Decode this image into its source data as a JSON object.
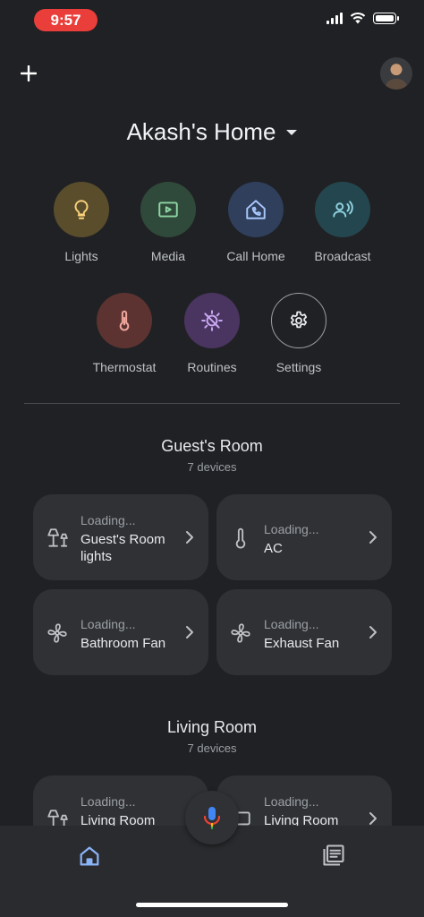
{
  "status_bar": {
    "time": "9:57"
  },
  "header": {
    "home_name": "Akash's Home"
  },
  "quick_actions": [
    {
      "label": "Lights",
      "icon": "lightbulb-icon",
      "bg": "#5a4d2c",
      "fg": "#f9d27a"
    },
    {
      "label": "Media",
      "icon": "media-play-icon",
      "bg": "#2f4a3a",
      "fg": "#8fd6a4"
    },
    {
      "label": "Call Home",
      "icon": "call-home-icon",
      "bg": "#2f3f5c",
      "fg": "#a8c7fa"
    },
    {
      "label": "Broadcast",
      "icon": "broadcast-icon",
      "bg": "#24474f",
      "fg": "#8fd1e0"
    },
    {
      "label": "Thermostat",
      "icon": "thermostat-icon",
      "bg": "#5c3331",
      "fg": "#f2a89e"
    },
    {
      "label": "Routines",
      "icon": "routines-icon",
      "bg": "#4a3560",
      "fg": "#c9a8f2"
    },
    {
      "label": "Settings",
      "icon": "gear-icon",
      "bg": "#202124",
      "fg": "#e8eaed"
    }
  ],
  "rooms": [
    {
      "name": "Guest's Room",
      "device_count": "7 devices",
      "devices": [
        {
          "status": "Loading...",
          "name": "Guest's Room lights",
          "icon": "lamp-icon"
        },
        {
          "status": "Loading...",
          "name": "AC",
          "icon": "thermometer-icon"
        },
        {
          "status": "Loading...",
          "name": "Bathroom Fan",
          "icon": "fan-icon"
        },
        {
          "status": "Loading...",
          "name": "Exhaust Fan",
          "icon": "fan-icon"
        }
      ]
    },
    {
      "name": "Living Room",
      "device_count": "7 devices",
      "devices": [
        {
          "status": "Loading...",
          "name": "Living Room",
          "icon": "lamp-icon"
        },
        {
          "status": "Loading...",
          "name": "Living Room",
          "icon": "tv-icon"
        }
      ]
    }
  ],
  "bottom_nav": [
    {
      "label": "Home",
      "icon": "home-icon",
      "active": true
    },
    {
      "label": "Feed",
      "icon": "feed-icon",
      "active": false
    }
  ],
  "colors": {
    "background": "#202124",
    "card": "#303134",
    "active_tab": "#8ab4f8"
  }
}
